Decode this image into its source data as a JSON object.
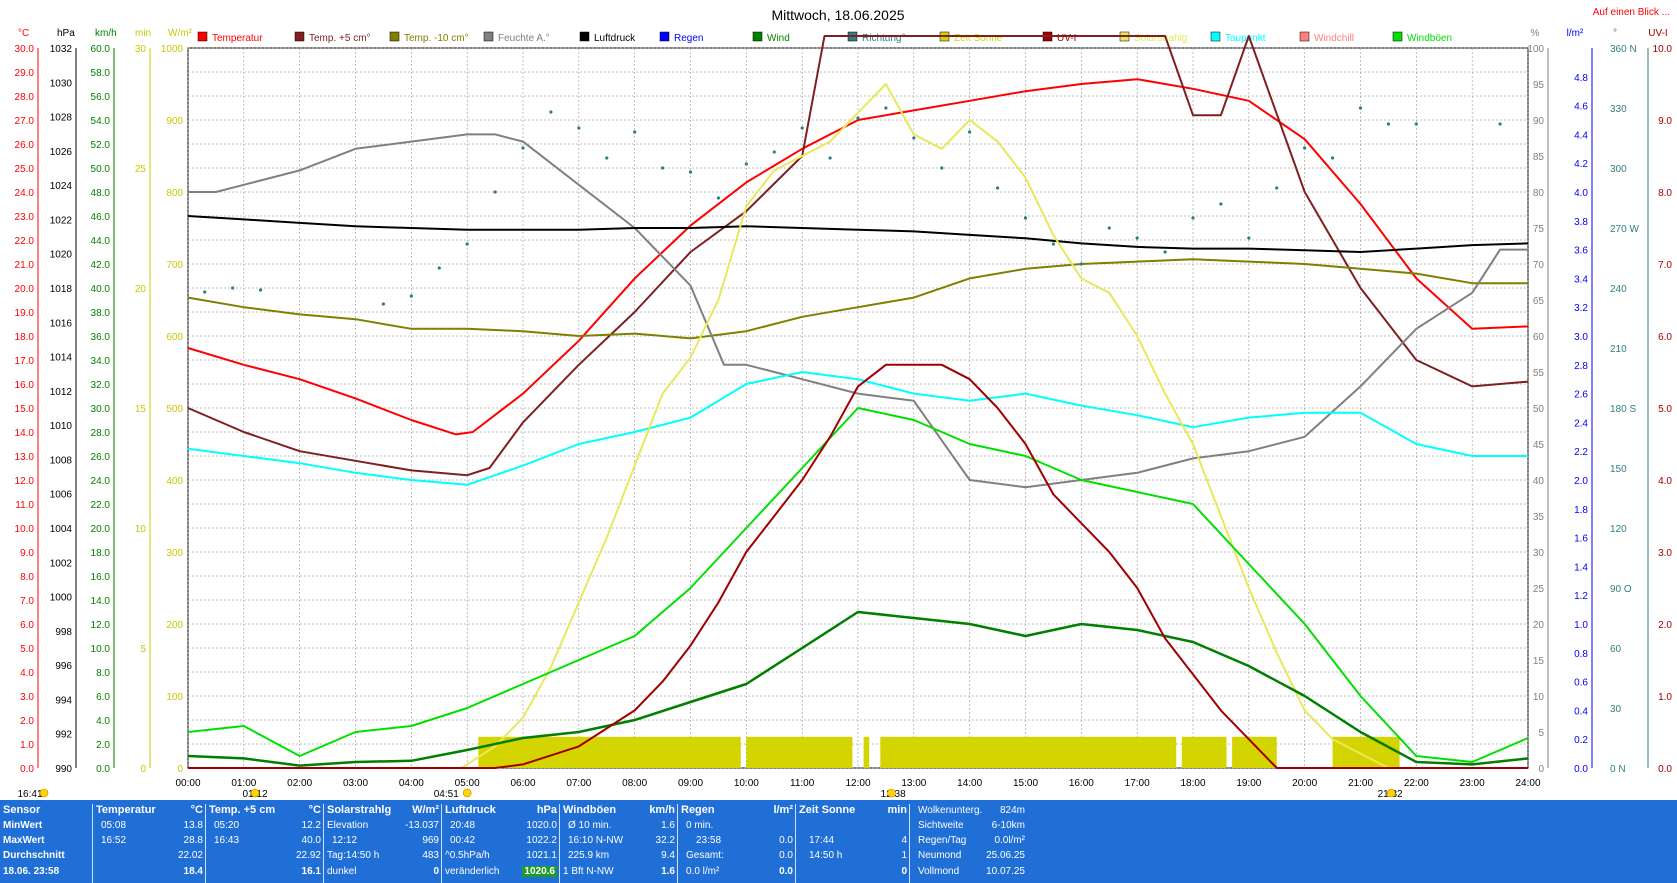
{
  "page": {
    "title": "Mittwoch, 18.06.2025",
    "overview_link": "Auf einen Blick ...",
    "marker_labels": [
      "16:41",
      "01:12",
      "04:51",
      "12:38",
      "21:32"
    ]
  },
  "legend": [
    {
      "label": "Temperatur",
      "color": "#ff0000"
    },
    {
      "label": "Temp. +5 cm°",
      "color": "#7f1f1f"
    },
    {
      "label": "Temp. -10 cm°",
      "color": "#7f7f00"
    },
    {
      "label": "Feuchte A.°",
      "color": "#808080"
    },
    {
      "label": "Luftdruck",
      "color": "#000000"
    },
    {
      "label": "Regen",
      "color": "#0000ff"
    },
    {
      "label": "Wind",
      "color": "#007f00"
    },
    {
      "label": "Richtung°",
      "color": "#2f7f7f"
    },
    {
      "label": "Zeit Sonne",
      "color": "#d4d400"
    },
    {
      "label": "UV-I",
      "color": "#a00000"
    },
    {
      "label": "Solarstrahlg",
      "color": "#e8e85a"
    },
    {
      "label": "Taupunkt",
      "color": "#00ffff"
    },
    {
      "label": "Windchill",
      "color": "#ff7f7f"
    },
    {
      "label": "Windböen",
      "color": "#00e000"
    }
  ],
  "axes_headers": {
    "left": [
      "°C",
      "hPa",
      "km/h",
      "min",
      "W/m²"
    ],
    "right": [
      "%",
      "l/m²",
      "°",
      "UV-I"
    ]
  },
  "chart_data": {
    "type": "line",
    "title": "Mittwoch, 18.06.2025",
    "x_ticks": [
      "00:00",
      "01:00",
      "02:00",
      "03:00",
      "04:00",
      "05:00",
      "06:00",
      "07:00",
      "08:00",
      "09:00",
      "10:00",
      "11:00",
      "12:00",
      "13:00",
      "14:00",
      "15:00",
      "16:00",
      "17:00",
      "18:00",
      "19:00",
      "20:00",
      "21:00",
      "22:00",
      "23:00",
      "24:00"
    ],
    "xlim_hours": [
      0,
      24
    ],
    "grid": true,
    "axes": {
      "temp_c": {
        "range": [
          0,
          30
        ],
        "ticks": [
          "30.0",
          "29.0",
          "28.0",
          "27.0",
          "26.0",
          "25.0",
          "24.0",
          "23.0",
          "22.0",
          "21.0",
          "20.0",
          "19.0",
          "18.0",
          "17.0",
          "16.0",
          "15.0",
          "14.0",
          "13.0",
          "12.0",
          "11.0",
          "10.0",
          "9.0",
          "8.0",
          "7.0",
          "6.0",
          "5.0",
          "4.0",
          "3.0",
          "2.0",
          "1.0",
          "0.0"
        ]
      },
      "pressure_hpa": {
        "range": [
          990,
          1032
        ],
        "ticks": [
          "1032",
          "1030",
          "1028",
          "1026",
          "1024",
          "1022",
          "1020",
          "1018",
          "1016",
          "1014",
          "1012",
          "1010",
          "1008",
          "1006",
          "1004",
          "1002",
          "1000",
          "998",
          "996",
          "994",
          "992",
          "990"
        ]
      },
      "wind_kmh": {
        "range": [
          0,
          60
        ],
        "ticks": [
          "60.0",
          "58.0",
          "56.0",
          "54.0",
          "52.0",
          "50.0",
          "48.0",
          "46.0",
          "44.0",
          "42.0",
          "40.0",
          "38.0",
          "36.0",
          "34.0",
          "32.0",
          "30.0",
          "28.0",
          "26.0",
          "24.0",
          "22.0",
          "20.0",
          "18.0",
          "16.0",
          "14.0",
          "12.0",
          "10.0",
          "8.0",
          "6.0",
          "4.0",
          "2.0",
          "0.0"
        ]
      },
      "sun_min": {
        "range": [
          0,
          30
        ],
        "ticks": [
          "30",
          "25",
          "20",
          "15",
          "10",
          "5",
          "0"
        ]
      },
      "solar_wm2": {
        "range": [
          0,
          1000
        ],
        "ticks": [
          "1000",
          "900",
          "800",
          "700",
          "600",
          "500",
          "400",
          "300",
          "200",
          "100",
          "0"
        ]
      },
      "humidity_pct": {
        "range": [
          0,
          100
        ],
        "ticks": [
          "100",
          "95",
          "90",
          "85",
          "80",
          "75",
          "70",
          "65",
          "60",
          "55",
          "50",
          "45",
          "40",
          "35",
          "30",
          "25",
          "20",
          "15",
          "10",
          "5",
          "0"
        ]
      },
      "rain_lm2": {
        "range": [
          0,
          5
        ],
        "ticks": [
          "4.8",
          "4.6",
          "4.4",
          "4.2",
          "4.0",
          "3.8",
          "3.6",
          "3.4",
          "3.2",
          "3.0",
          "2.8",
          "2.6",
          "2.4",
          "2.2",
          "2.0",
          "1.8",
          "1.6",
          "1.4",
          "1.2",
          "1.0",
          "0.8",
          "0.6",
          "0.4",
          "0.2",
          "0.0"
        ]
      },
      "direction_deg": {
        "range": [
          0,
          360
        ],
        "ticks": [
          "360 N",
          "330",
          "300",
          "270 W",
          "240",
          "210",
          "180 S",
          "150",
          "120",
          "90 O",
          "60",
          "30",
          "0 N"
        ]
      },
      "uv_index": {
        "range": [
          0,
          10
        ],
        "ticks": [
          "10.0",
          "9.0",
          "8.0",
          "7.0",
          "6.0",
          "5.0",
          "4.0",
          "3.0",
          "2.0",
          "1.0",
          "0.0"
        ]
      }
    },
    "series": [
      {
        "name": "Temperatur",
        "axis": "temp_c",
        "color": "#ff0000",
        "x": [
          0,
          1,
          2,
          3,
          4,
          4.8,
          5.1,
          6,
          7,
          8,
          9,
          10,
          11,
          12,
          13,
          14,
          15,
          16,
          17,
          18,
          19,
          20,
          21,
          22,
          23,
          24
        ],
        "y": [
          17.5,
          16.8,
          16.2,
          15.4,
          14.5,
          13.9,
          14.0,
          15.6,
          17.8,
          20.4,
          22.6,
          24.4,
          25.8,
          27.0,
          27.4,
          27.8,
          28.2,
          28.5,
          28.7,
          28.3,
          27.8,
          26.2,
          23.5,
          20.4,
          18.3,
          18.4
        ]
      },
      {
        "name": "Temp. +5 cm°",
        "axis": "temp_c",
        "color": "#7f1f1f",
        "x": [
          0,
          1,
          2,
          3,
          4,
          5,
          5.4,
          6,
          7,
          8,
          9,
          10,
          11,
          11.4,
          17.5,
          18,
          18.5,
          19,
          20,
          21,
          22,
          23,
          24
        ],
        "y": [
          15.0,
          14.0,
          13.2,
          12.8,
          12.4,
          12.2,
          12.5,
          14.4,
          16.8,
          19.0,
          21.5,
          23.2,
          25.5,
          30.5,
          30.5,
          27.2,
          27.2,
          30.5,
          24.0,
          20.0,
          17.0,
          15.9,
          16.1
        ]
      },
      {
        "name": "Temp. -10 cm°",
        "axis": "temp_c",
        "color": "#7f7f00",
        "x": [
          0,
          1,
          2,
          3,
          4,
          5,
          6,
          7,
          8,
          9,
          10,
          11,
          12,
          13,
          14,
          15,
          16,
          17,
          18,
          19,
          20,
          21,
          22,
          23,
          24
        ],
        "y": [
          19.6,
          19.2,
          18.9,
          18.7,
          18.3,
          18.3,
          18.2,
          18.0,
          18.1,
          17.9,
          18.2,
          18.8,
          19.2,
          19.6,
          20.4,
          20.8,
          21.0,
          21.1,
          21.2,
          21.1,
          21.0,
          20.8,
          20.6,
          20.2,
          20.2
        ]
      },
      {
        "name": "Feuchte A.°",
        "axis": "humidity_pct",
        "color": "#808080",
        "x": [
          0,
          0.5,
          1,
          2,
          3,
          4,
          5,
          5.5,
          6,
          7,
          8,
          9,
          9.6,
          10,
          11,
          12,
          13,
          14,
          15,
          16,
          17,
          18,
          19,
          20,
          21,
          22,
          23,
          23.5,
          24
        ],
        "y": [
          80,
          80,
          81,
          83,
          86,
          87,
          88,
          88,
          87,
          81,
          75,
          67,
          56,
          56,
          54,
          52,
          51,
          40,
          39,
          40,
          41,
          43,
          44,
          46,
          53,
          61,
          66,
          72,
          72
        ]
      },
      {
        "name": "Luftdruck",
        "axis": "pressure_hpa",
        "color": "#000000",
        "x": [
          0,
          1,
          2,
          3,
          4,
          5,
          6,
          7,
          8,
          9,
          10,
          11,
          12,
          13,
          14,
          15,
          16,
          17,
          18,
          19,
          20,
          21,
          22,
          23,
          24
        ],
        "y": [
          1022.2,
          1022.0,
          1021.8,
          1021.6,
          1021.5,
          1021.4,
          1021.4,
          1021.4,
          1021.5,
          1021.5,
          1021.6,
          1021.5,
          1021.4,
          1021.3,
          1021.1,
          1020.9,
          1020.6,
          1020.4,
          1020.3,
          1020.3,
          1020.2,
          1020.1,
          1020.3,
          1020.5,
          1020.6
        ]
      },
      {
        "name": "Taupunkt",
        "axis": "temp_c",
        "color": "#00ffff",
        "x": [
          0,
          1,
          2,
          3,
          4,
          5,
          6,
          7,
          8,
          9,
          10,
          11,
          12,
          13,
          14,
          15,
          16,
          17,
          18,
          19,
          20,
          21,
          22,
          23,
          24
        ],
        "y": [
          13.3,
          13.0,
          12.7,
          12.3,
          12.0,
          11.8,
          12.6,
          13.5,
          14.0,
          14.6,
          16.0,
          16.5,
          16.2,
          15.6,
          15.3,
          15.6,
          15.1,
          14.7,
          14.2,
          14.6,
          14.8,
          14.8,
          13.5,
          13.0,
          13.0
        ]
      },
      {
        "name": "Solarstrahlg",
        "axis": "solar_wm2",
        "color": "#e8e85a",
        "x": [
          0,
          4.9,
          5.5,
          6,
          6.5,
          7,
          7.5,
          8,
          8.5,
          9,
          9.5,
          10,
          10.5,
          11,
          11.5,
          12,
          12.5,
          13,
          13.5,
          14,
          14.5,
          15,
          15.5,
          16,
          16.5,
          17,
          17.5,
          18,
          18.5,
          19,
          19.5,
          20,
          20.5,
          21,
          21.5,
          24
        ],
        "y": [
          0,
          0,
          30,
          70,
          140,
          230,
          320,
          420,
          520,
          570,
          650,
          780,
          830,
          850,
          870,
          910,
          950,
          880,
          860,
          900,
          870,
          820,
          740,
          680,
          660,
          600,
          520,
          450,
          350,
          250,
          160,
          80,
          40,
          20,
          0,
          0
        ]
      },
      {
        "name": "Wind",
        "axis": "wind_kmh",
        "color": "#007f00",
        "x": [
          0,
          1,
          2,
          3,
          4,
          5,
          6,
          7,
          8,
          9,
          10,
          11,
          12,
          13,
          14,
          15,
          16,
          17,
          18,
          19,
          20,
          21,
          22,
          23,
          24
        ],
        "y": [
          1.0,
          0.8,
          0.2,
          0.5,
          0.6,
          1.5,
          2.5,
          3.0,
          4.0,
          5.5,
          7.0,
          10.0,
          13.0,
          12.5,
          12.0,
          11.0,
          12.0,
          11.5,
          10.5,
          8.5,
          6.0,
          3.0,
          0.5,
          0.3,
          0.8
        ]
      },
      {
        "name": "Windböen",
        "axis": "wind_kmh",
        "color": "#00e000",
        "x": [
          0,
          1,
          2,
          3,
          4,
          5,
          6,
          7,
          8,
          9,
          10,
          11,
          12,
          13,
          14,
          15,
          16,
          17,
          18,
          19,
          20,
          21,
          22,
          23,
          24
        ],
        "y": [
          3.0,
          3.5,
          1.0,
          3.0,
          3.5,
          5.0,
          7.0,
          9.0,
          11.0,
          15.0,
          20.0,
          25.0,
          30.0,
          29.0,
          27.0,
          26.0,
          24.0,
          23.0,
          22.0,
          17.0,
          12.0,
          6.0,
          1.0,
          0.5,
          2.5
        ]
      },
      {
        "name": "UV-I",
        "axis": "uv_index",
        "color": "#a00000",
        "x": [
          0,
          5.5,
          6,
          7,
          8,
          8.5,
          9,
          9.5,
          10,
          10.5,
          11,
          11.5,
          12,
          12.5,
          13,
          13.5,
          14,
          14.5,
          15,
          15.5,
          16,
          16.5,
          17,
          17.5,
          18,
          18.5,
          19,
          19.5,
          24
        ],
        "y": [
          0,
          0,
          0.05,
          0.3,
          0.8,
          1.2,
          1.7,
          2.3,
          3.0,
          3.5,
          4.0,
          4.6,
          5.3,
          5.6,
          5.6,
          5.6,
          5.4,
          5.0,
          4.5,
          3.8,
          3.4,
          3.0,
          2.5,
          1.8,
          1.3,
          0.8,
          0.4,
          0.0,
          0.0
        ]
      }
    ],
    "direction_points": {
      "name": "Richtung°",
      "axis": "direction_deg",
      "color": "#2f7f7f",
      "x": [
        0.3,
        0.8,
        1.3,
        3.5,
        4,
        4.5,
        5,
        5.5,
        6,
        6.5,
        7,
        7.5,
        8,
        8.5,
        9,
        9.5,
        10,
        10.5,
        11,
        11.5,
        12,
        12.5,
        13,
        13.5,
        14,
        14.5,
        15,
        15.5,
        16,
        16.5,
        17,
        17.5,
        18,
        18.5,
        19,
        19.5,
        20,
        20.5,
        21,
        21.5,
        22,
        23.5
      ],
      "y": [
        238,
        240,
        239,
        232,
        236,
        250,
        262,
        288,
        310,
        328,
        320,
        305,
        318,
        300,
        298,
        285,
        302,
        308,
        320,
        305,
        325,
        330,
        315,
        300,
        318,
        290,
        275,
        262,
        252,
        270,
        265,
        258,
        275,
        282,
        265,
        290,
        310,
        305,
        330,
        322,
        322,
        322
      ]
    },
    "sunshine_hours": {
      "name": "Zeit Sonne",
      "axis": "sun_min",
      "color": "#d4d400",
      "periods": [
        [
          5.2,
          9.9
        ],
        [
          10.0,
          11.9
        ],
        [
          12.1,
          12.2
        ],
        [
          12.4,
          17.7
        ],
        [
          17.8,
          18.6
        ],
        [
          18.7,
          19.5
        ],
        [
          20.5,
          21.7
        ]
      ],
      "value": 1.3
    }
  },
  "summary": {
    "sensor": {
      "header": "Sensor",
      "rows": [
        "MinWert",
        "MaxWert",
        "Durchschnitt"
      ],
      "date": "18.06. 23:58"
    },
    "temperatur": {
      "header": "Temperatur",
      "unit": "°C",
      "rows": [
        [
          "05:08",
          "13.8"
        ],
        [
          "16:52",
          "28.8"
        ],
        [
          "",
          "22.02"
        ]
      ],
      "current": "18.4"
    },
    "temp5": {
      "header": "Temp. +5 cm",
      "unit": "°C",
      "rows": [
        [
          "05:20",
          "12.2"
        ],
        [
          "16:43",
          "40.0"
        ],
        [
          "",
          "22.92"
        ]
      ],
      "current": "16.1"
    },
    "solar": {
      "header": "Solarstrahlg",
      "unit": "W/m²",
      "rows": [
        [
          "Elevation",
          "-13.037"
        ],
        [
          "12:12",
          "969"
        ],
        [
          "Tag:14:50 h",
          "483"
        ]
      ],
      "last": [
        "dunkel",
        "0"
      ]
    },
    "luftdruck": {
      "header": "Luftdruck",
      "unit": "hPa",
      "rows": [
        [
          "20:48",
          "1020.0"
        ],
        [
          "00:42",
          "1022.2"
        ],
        [
          "^0.5hPa/h",
          "1021.1"
        ]
      ],
      "last": [
        "veränderlich",
        "1020.6"
      ]
    },
    "windboen": {
      "header": "Windböen",
      "unit": "km/h",
      "rows": [
        [
          "Ø 10 min.",
          "1.6"
        ],
        [
          "16:10  N-NW",
          "32.2"
        ],
        [
          "225.9 km",
          "9.4"
        ]
      ],
      "last": [
        "1 Bft N-NW",
        "1.6"
      ]
    },
    "regen": {
      "header": "Regen",
      "unit": "l/m²",
      "rows": [
        [
          "0 min.",
          ""
        ],
        [
          "23:58",
          "0.0"
        ],
        [
          "Gesamt:",
          "0.0"
        ]
      ],
      "last": [
        "0.0 l/m²",
        "0.0"
      ]
    },
    "sonne": {
      "header": "Zeit Sonne",
      "unit": "min",
      "rows": [
        [
          "",
          ""
        ],
        [
          "17:44",
          "4"
        ],
        [
          "14:50 h",
          "1"
        ]
      ],
      "last": [
        "",
        "0"
      ]
    },
    "extra": {
      "rows": [
        [
          "Wolkenunterg.",
          "824m"
        ],
        [
          "Sichtweite",
          "6-10km"
        ],
        [
          "Regen/Tag",
          "0.0l/m²"
        ],
        [
          "Neumond",
          "25.06.25"
        ],
        [
          "Vollmond",
          "10.07.25"
        ]
      ]
    }
  }
}
